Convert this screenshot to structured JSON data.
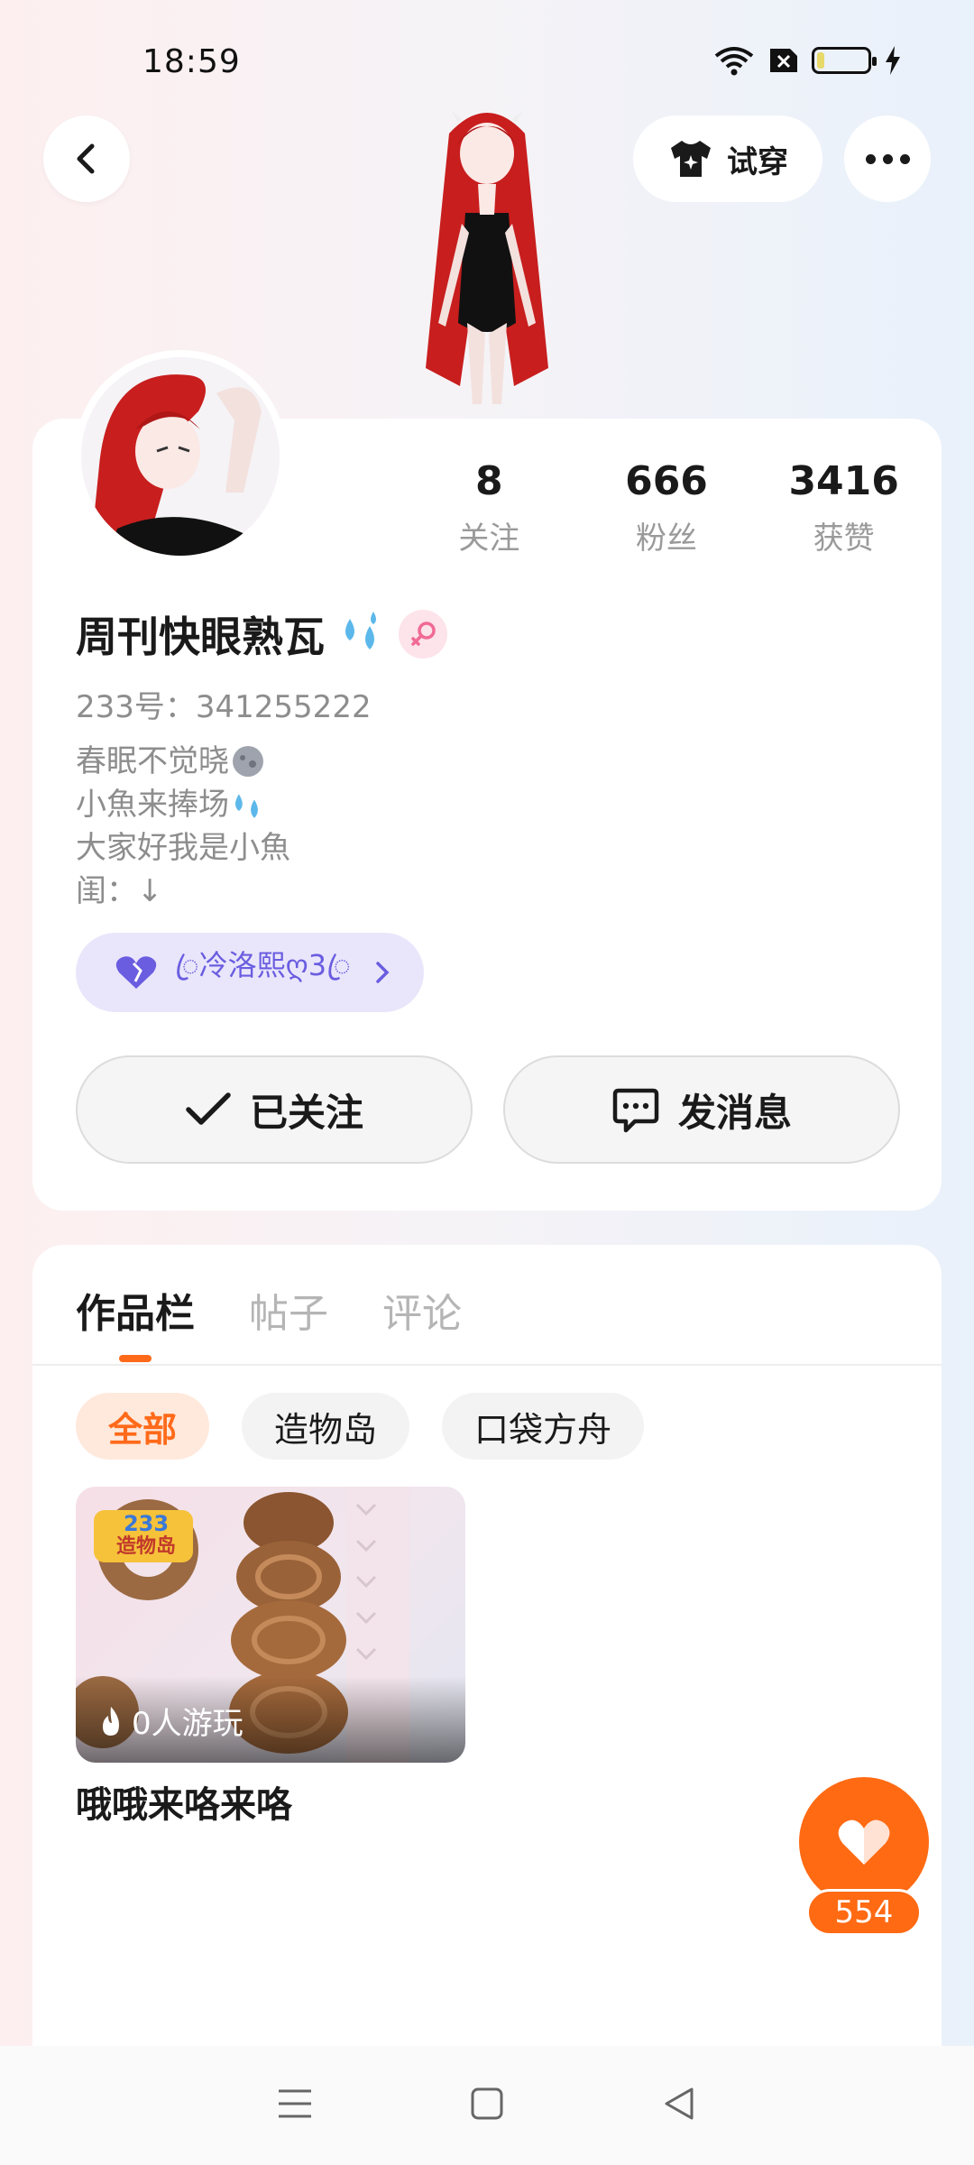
{
  "status_bar": {
    "time": "18:59"
  },
  "header": {
    "tryon_label": "试穿"
  },
  "stats": [
    {
      "value": "8",
      "label": "关注"
    },
    {
      "value": "666",
      "label": "粉丝"
    },
    {
      "value": "3416",
      "label": "获赞"
    }
  ],
  "profile": {
    "nickname": "周刊快眼熟瓦",
    "user_id": "233号：341255222",
    "bio_lines": [
      "春眠不觉晓",
      "小魚来捧场",
      "大家好我是小魚",
      "闺：↓"
    ],
    "relation_name": "ꦿ冷洛熙ღ3ꦿ"
  },
  "actions": {
    "follow_label": "已关注",
    "message_label": "发消息"
  },
  "tabs": [
    "作品栏",
    "帖子",
    "评论"
  ],
  "filters": [
    "全部",
    "造物岛",
    "口袋方舟"
  ],
  "works": [
    {
      "title": "哦哦来咯来咯",
      "play_count": "0人游玩",
      "badge_top": "233",
      "badge_bottom": "造物岛"
    }
  ],
  "like": {
    "count": "554"
  },
  "colors": {
    "accent": "#ff6a13",
    "relation_bg": "#e9e6fb",
    "relation_text": "#6a5de0"
  }
}
